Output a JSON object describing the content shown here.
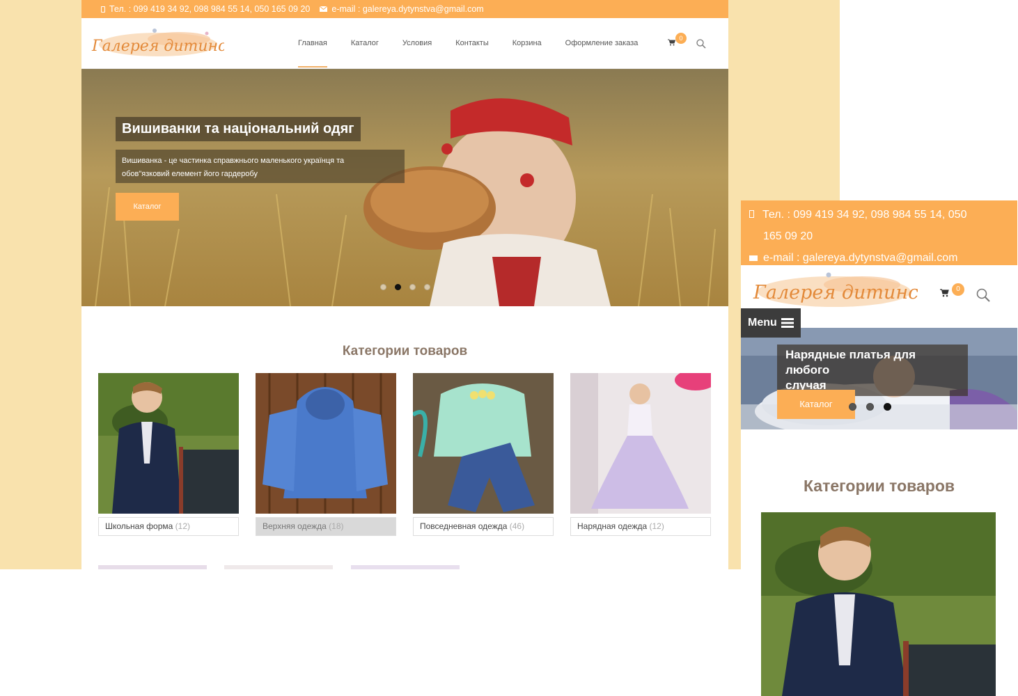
{
  "site": {
    "logo_text": "Галерея дитинства",
    "phone": "Тел. : 099 419 34 92, 098 984 55 14, 050 165 09 20",
    "email": "e-mail : galereya.dytynstva@gmail.com",
    "mobile_phone_line1": "Тел. : 099 419 34 92, 098 984 55 14, 050",
    "mobile_phone_line2": "165 09 20",
    "accent": "#fcae55",
    "background": "#f9e2ad"
  },
  "nav": {
    "items": [
      {
        "label": "Главная",
        "active": true
      },
      {
        "label": "Каталог"
      },
      {
        "label": "Условия"
      },
      {
        "label": "Контакты"
      },
      {
        "label": "Корзина"
      },
      {
        "label": "Оформление заказа"
      }
    ],
    "cart_count": "0",
    "cart_icon": "cart-icon",
    "search_icon": "search-icon"
  },
  "hero": {
    "title": "Вишиванки та національний одяг",
    "desc_line1": "Вишиванка - це частинка справжнього маленького українця та",
    "desc_line2": "обов\"язковий елемент його гардеробу",
    "button": "Каталог",
    "active_slide": 2,
    "slides": 4
  },
  "categories": {
    "title": "Категории товаров",
    "items": [
      {
        "name": "Школьная форма",
        "count": "(12)"
      },
      {
        "name": "Верхняя одежда",
        "count": "(18)"
      },
      {
        "name": "Повседневная одежда",
        "count": "(46)"
      },
      {
        "name": "Нарядная одежда",
        "count": "(12)"
      }
    ]
  },
  "mobile": {
    "menu": "Menu",
    "hero_title_line1": "Нарядные платья для любого",
    "hero_title_line2": "случая",
    "hero_button": "Каталог",
    "cart_count": "0",
    "categories_title": "Категории товаров"
  }
}
